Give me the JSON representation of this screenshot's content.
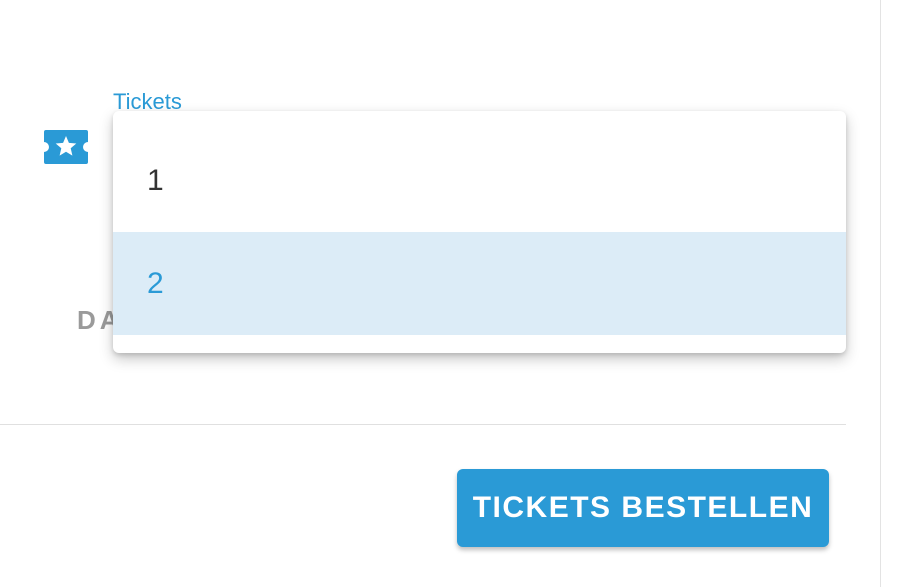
{
  "colors": {
    "accent": "#2a9ad6",
    "selected_bg": "#dcecf7",
    "text_dark": "#333333",
    "text_muted": "#9a9a9a"
  },
  "tickets_field": {
    "label": "Tickets",
    "icon": "ticket-star-icon",
    "options": [
      {
        "label": "1",
        "selected": false
      },
      {
        "label": "2",
        "selected": true
      }
    ]
  },
  "partial_text": "DA",
  "actions": {
    "order_button": "TICKETS BESTELLEN"
  }
}
